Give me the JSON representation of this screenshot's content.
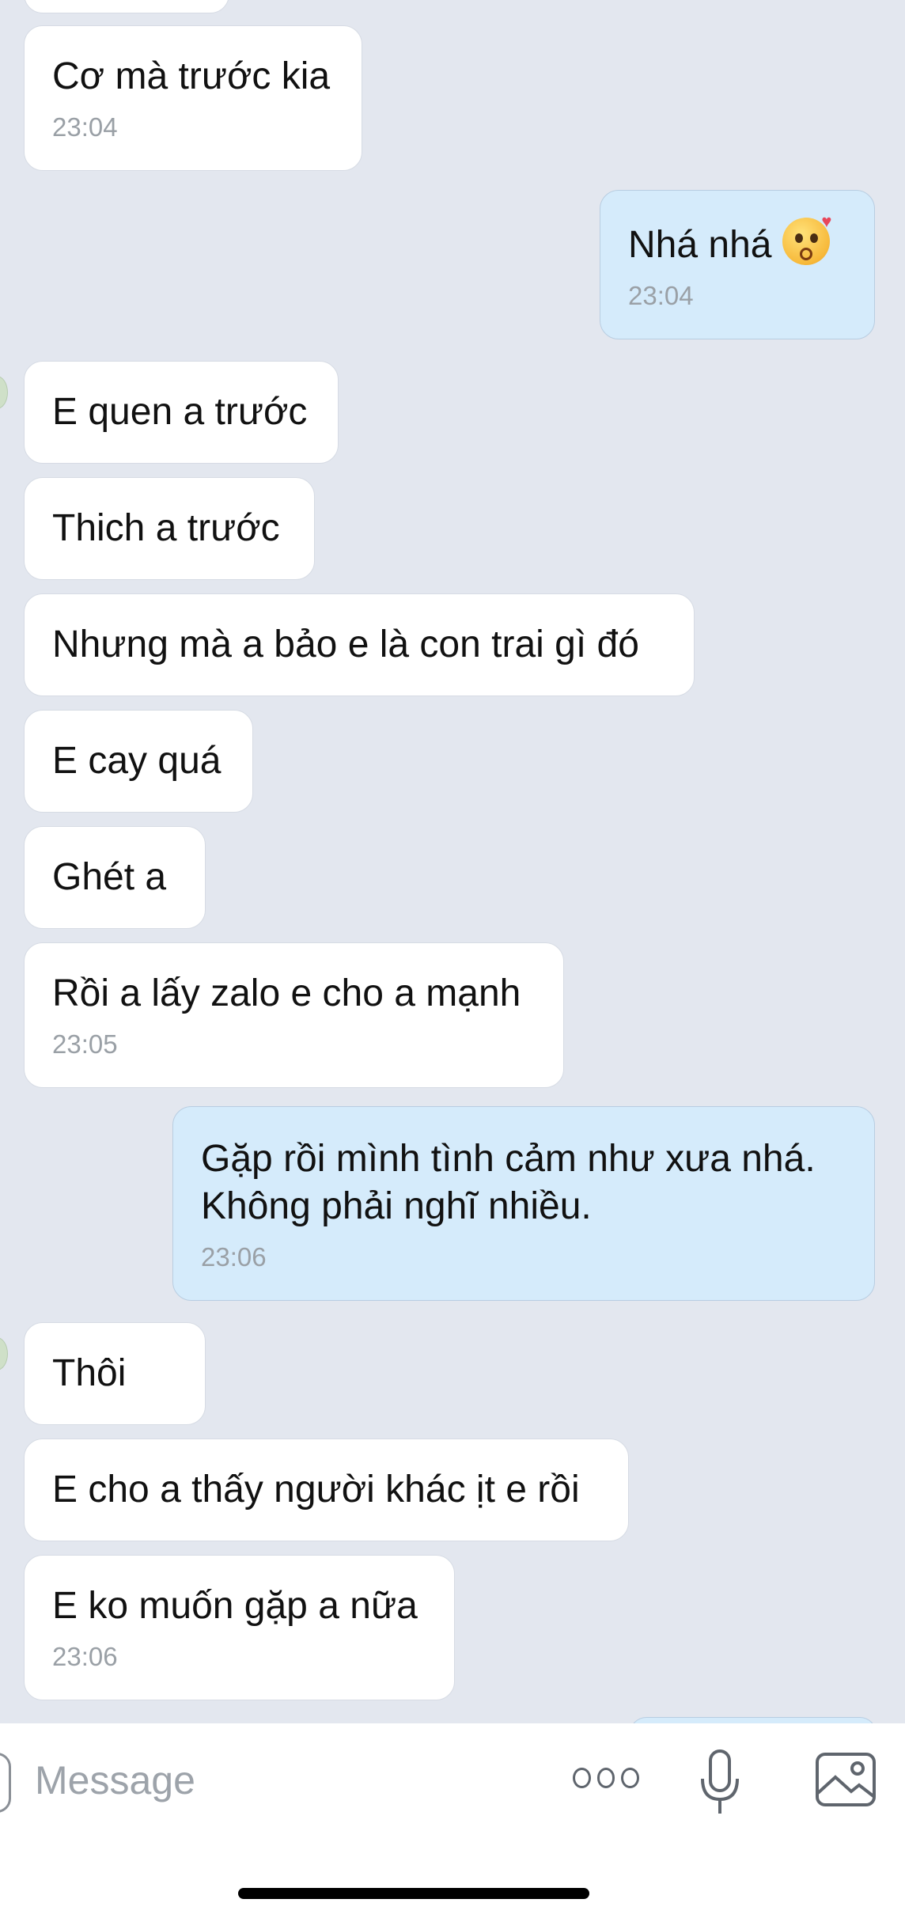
{
  "messages": [
    {
      "id": "m1",
      "side": "them",
      "text": "Cơ mà trước kia",
      "time": "23:04"
    },
    {
      "id": "m2",
      "side": "me",
      "text": "Nhá nhá",
      "emoji": "kissing-face-with-heart",
      "time": "23:04"
    },
    {
      "id": "m3",
      "side": "them",
      "text": "E quen a trước"
    },
    {
      "id": "m4",
      "side": "them",
      "text": "Thich a trước"
    },
    {
      "id": "m5",
      "side": "them",
      "text": "Nhưng mà a bảo e là con trai gì đó"
    },
    {
      "id": "m6",
      "side": "them",
      "text": "E cay quá"
    },
    {
      "id": "m7",
      "side": "them",
      "text": "Ghét a"
    },
    {
      "id": "m8",
      "side": "them",
      "text": "Rồi a lấy zalo e cho a mạnh",
      "time": "23:05"
    },
    {
      "id": "m9",
      "side": "me",
      "text": "Gặp rồi mình tình cảm như xưa nhá. Không phải nghĩ nhiều.",
      "time": "23:06"
    },
    {
      "id": "m10",
      "side": "them",
      "text": "Thôi"
    },
    {
      "id": "m11",
      "side": "them",
      "text": "E cho a thấy người khác ịt e rồi"
    },
    {
      "id": "m12",
      "side": "them",
      "text": "E ko muốn gặp a nữa",
      "time": "23:06"
    }
  ],
  "composer": {
    "placeholder": "Message",
    "icons": [
      "more-options-icon",
      "microphone-icon",
      "image-icon"
    ]
  },
  "colors": {
    "background": "#e3e7ef",
    "incoming_bubble": "#ffffff",
    "outgoing_bubble": "#d5ebfb",
    "timestamp": "#9aa0a6"
  }
}
